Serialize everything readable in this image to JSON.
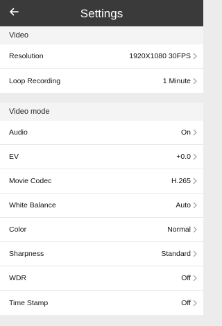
{
  "header": {
    "title": "Settings",
    "back_icon": "arrow-left-icon"
  },
  "sections": [
    {
      "title": "Video",
      "items": [
        {
          "label": "Resolution",
          "value": "1920X1080 30FPS"
        },
        {
          "label": "Loop Recording",
          "value": "1 Minute"
        }
      ]
    },
    {
      "title": "Video mode",
      "items": [
        {
          "label": "Audio",
          "value": "On"
        },
        {
          "label": "EV",
          "value": "+0.0"
        },
        {
          "label": "Movie Codec",
          "value": "H.265"
        },
        {
          "label": "White Balance",
          "value": "Auto"
        },
        {
          "label": "Color",
          "value": "Normal"
        },
        {
          "label": "Sharpness",
          "value": "Standard"
        },
        {
          "label": "WDR",
          "value": "Off"
        },
        {
          "label": "Time Stamp",
          "value": "Off"
        }
      ]
    }
  ],
  "colors": {
    "header_bg": "#3a3a3a",
    "page_bg": "#ececec",
    "row_bg": "#ffffff",
    "chevron": "#9a9a9a"
  }
}
